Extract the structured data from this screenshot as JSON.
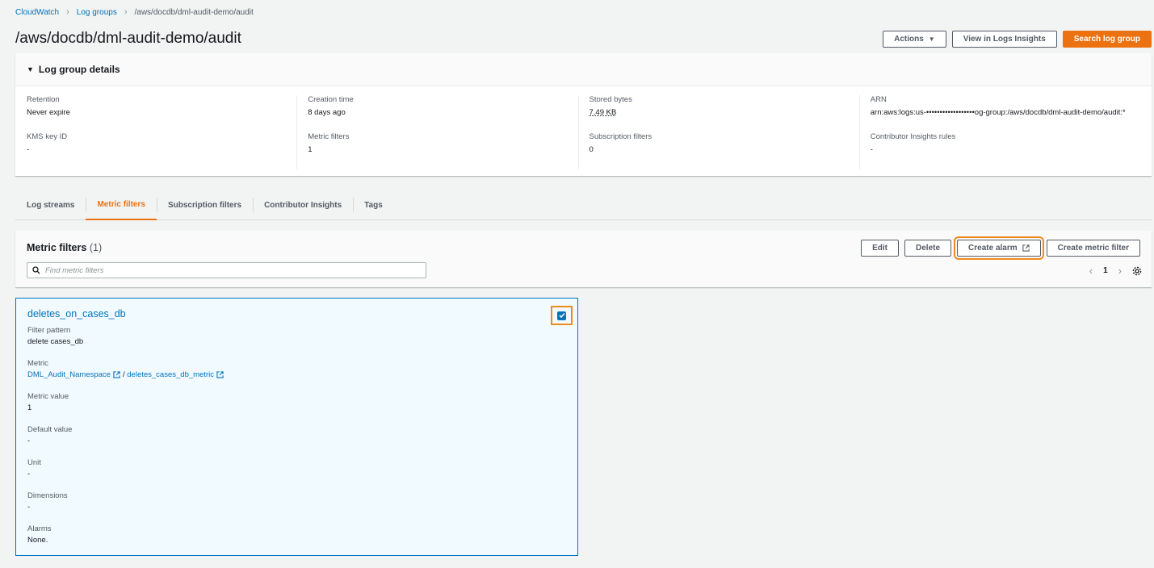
{
  "breadcrumb": {
    "items": [
      "CloudWatch",
      "Log groups"
    ],
    "current": "/aws/docdb/dml-audit-demo/audit"
  },
  "page_title": "/aws/docdb/dml-audit-demo/audit",
  "header_actions": {
    "actions": "Actions",
    "view_insights": "View in Logs Insights",
    "search": "Search log group"
  },
  "details": {
    "title": "Log group details",
    "retention_label": "Retention",
    "retention_value": "Never expire",
    "kms_label": "KMS key ID",
    "kms_value": "-",
    "creation_label": "Creation time",
    "creation_value": "8 days ago",
    "metric_filters_label": "Metric filters",
    "metric_filters_value": "1",
    "stored_label": "Stored bytes",
    "stored_value": "7.49 KB",
    "subscription_label": "Subscription filters",
    "subscription_value": "0",
    "arn_label": "ARN",
    "arn_value": "arn:aws:logs:us-••••••••••••••••••og-group:/aws/docdb/dml-audit-demo/audit:*",
    "contributor_label": "Contributor Insights rules",
    "contributor_value": "-"
  },
  "tabs": [
    "Log streams",
    "Metric filters",
    "Subscription filters",
    "Contributor Insights",
    "Tags"
  ],
  "metric_filters_panel": {
    "title": "Metric filters",
    "count": "(1)",
    "edit": "Edit",
    "delete": "Delete",
    "create_alarm": "Create alarm",
    "create_filter": "Create metric filter",
    "search_placeholder": "Find metric filters",
    "page": "1"
  },
  "filter_card": {
    "name": "deletes_on_cases_db",
    "filter_pattern_label": "Filter pattern",
    "filter_pattern_value": "delete cases_db",
    "metric_label": "Metric",
    "metric_namespace": "DML_Audit_Namespace",
    "metric_sep": "/",
    "metric_name": "deletes_cases_db_metric",
    "metric_value_label": "Metric value",
    "metric_value_value": "1",
    "default_value_label": "Default value",
    "default_value_value": "-",
    "unit_label": "Unit",
    "unit_value": "-",
    "dimensions_label": "Dimensions",
    "dimensions_value": "-",
    "alarms_label": "Alarms",
    "alarms_value": "None.",
    "selected": true
  },
  "colors": {
    "accent": "#ec7211",
    "link": "#0073bb",
    "card_bg": "#f1faff"
  }
}
